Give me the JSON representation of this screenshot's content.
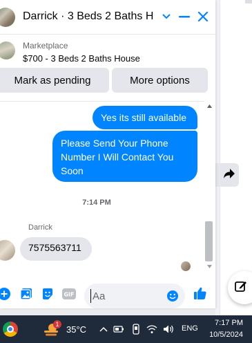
{
  "header": {
    "title": "Darrick · 3 Beds 2 Baths H...",
    "accent_color": "#0084ff"
  },
  "listing": {
    "source": "Marketplace",
    "title": "$700 - 3 Beds 2 Baths House"
  },
  "actions": {
    "mark_pending_label": "Mark as pending",
    "more_options_label": "More options"
  },
  "messages": {
    "outgoing": [
      "Yes its still available",
      "Please Send Your Phone Number I Will Contact You Soon"
    ],
    "timestamp": "7:14 PM",
    "sender_name": "Darrick",
    "incoming": [
      "7575563711"
    ]
  },
  "composer": {
    "placeholder": "Aa",
    "icons": [
      "plus-circle-icon",
      "photo-icon",
      "sticker-icon",
      "gif-icon",
      "emoji-icon",
      "thumbs-up-icon"
    ]
  },
  "taskbar": {
    "temperature": "35°C",
    "weather_badge": "1",
    "language": "ENG",
    "time": "7:17 PM",
    "date": "10/5/2024"
  }
}
